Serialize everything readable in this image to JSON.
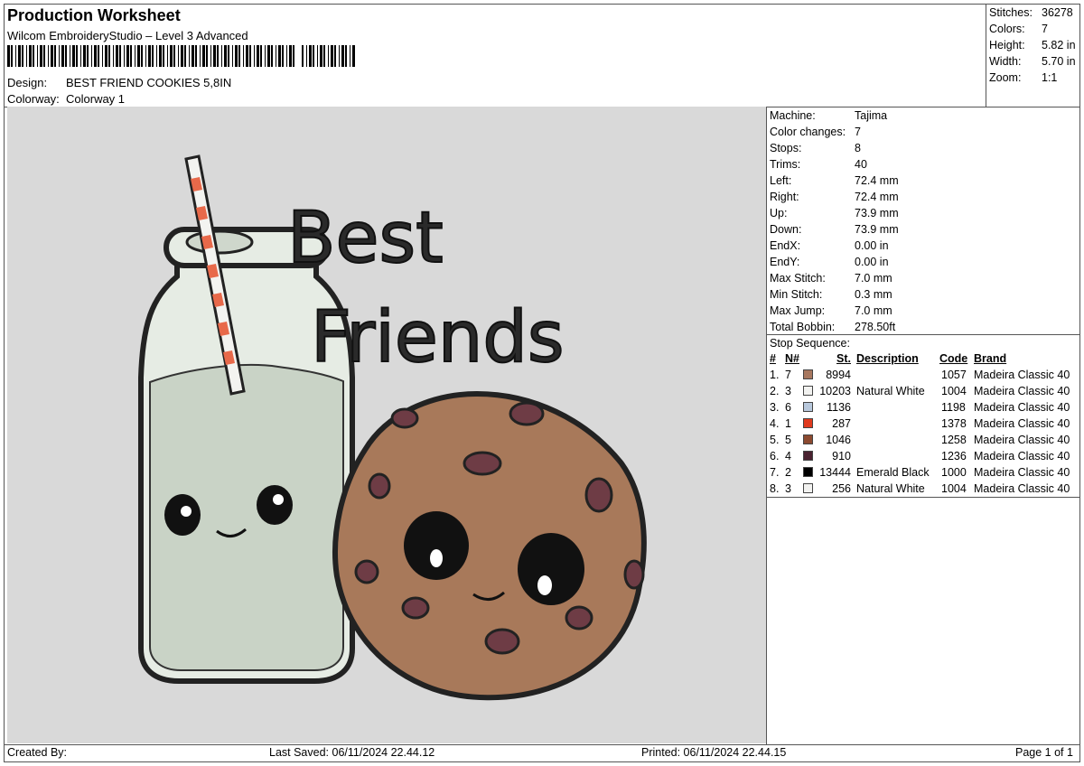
{
  "header": {
    "title": "Production Worksheet",
    "software": "Wilcom EmbroideryStudio – Level 3 Advanced",
    "design_label": "Design:",
    "design_value": "BEST FRIEND COOKIES 5,8IN",
    "colorway_label": "Colorway:",
    "colorway_value": "Colorway 1"
  },
  "summary": [
    {
      "label": "Stitches:",
      "value": "36278"
    },
    {
      "label": "Colors:",
      "value": "7"
    },
    {
      "label": "Height:",
      "value": "5.82 in"
    },
    {
      "label": "Width:",
      "value": "5.70 in"
    },
    {
      "label": "Zoom:",
      "value": "1:1"
    }
  ],
  "machine_info": [
    {
      "label": "Machine:",
      "value": "Tajima"
    },
    {
      "label": "Color changes:",
      "value": "7"
    },
    {
      "label": "Stops:",
      "value": "8"
    },
    {
      "label": "Trims:",
      "value": "40"
    },
    {
      "label": "Left:",
      "value": "72.4 mm"
    },
    {
      "label": "Right:",
      "value": "72.4 mm"
    },
    {
      "label": "Up:",
      "value": "73.9 mm"
    },
    {
      "label": "Down:",
      "value": "73.9 mm"
    },
    {
      "label": "EndX:",
      "value": "0.00 in"
    },
    {
      "label": "EndY:",
      "value": "0.00 in"
    },
    {
      "label": "Max Stitch:",
      "value": "7.0 mm"
    },
    {
      "label": "Min Stitch:",
      "value": "0.3 mm"
    },
    {
      "label": "Max Jump:",
      "value": "7.0 mm"
    },
    {
      "label": "Total Bobbin:",
      "value": "278.50ft"
    }
  ],
  "stop_sequence": {
    "title": "Stop Sequence:",
    "headers": {
      "num": "#",
      "n": "N#",
      "st": "St.",
      "desc": "Description",
      "code": "Code",
      "brand": "Brand"
    },
    "rows": [
      {
        "num": "1.",
        "n": "7",
        "color": "#a87860",
        "st": "8994",
        "desc": "",
        "code": "1057",
        "brand": "Madeira Classic 40"
      },
      {
        "num": "2.",
        "n": "3",
        "color": "#f2f2f0",
        "st": "10203",
        "desc": "Natural White",
        "code": "1004",
        "brand": "Madeira Classic 40"
      },
      {
        "num": "3.",
        "n": "6",
        "color": "#b8c8dc",
        "st": "1136",
        "desc": "",
        "code": "1198",
        "brand": "Madeira Classic 40"
      },
      {
        "num": "4.",
        "n": "1",
        "color": "#e03a1e",
        "st": "287",
        "desc": "",
        "code": "1378",
        "brand": "Madeira Classic 40"
      },
      {
        "num": "5.",
        "n": "5",
        "color": "#8c4a30",
        "st": "1046",
        "desc": "",
        "code": "1258",
        "brand": "Madeira Classic 40"
      },
      {
        "num": "6.",
        "n": "4",
        "color": "#4a2230",
        "st": "910",
        "desc": "",
        "code": "1236",
        "brand": "Madeira Classic 40"
      },
      {
        "num": "7.",
        "n": "2",
        "color": "#000000",
        "st": "13444",
        "desc": "Emerald Black",
        "code": "1000",
        "brand": "Madeira Classic 40"
      },
      {
        "num": "8.",
        "n": "3",
        "color": "#f2f2f0",
        "st": "256",
        "desc": "Natural White",
        "code": "1004",
        "brand": "Madeira Classic 40"
      }
    ]
  },
  "design_text": {
    "line1": "Best",
    "line2": "Friends"
  },
  "footer": {
    "created_by": "Created By:",
    "last_saved": "Last Saved: 06/11/2024 22.44.12",
    "printed": "Printed: 06/11/2024 22.44.15",
    "page": "Page 1 of 1"
  }
}
